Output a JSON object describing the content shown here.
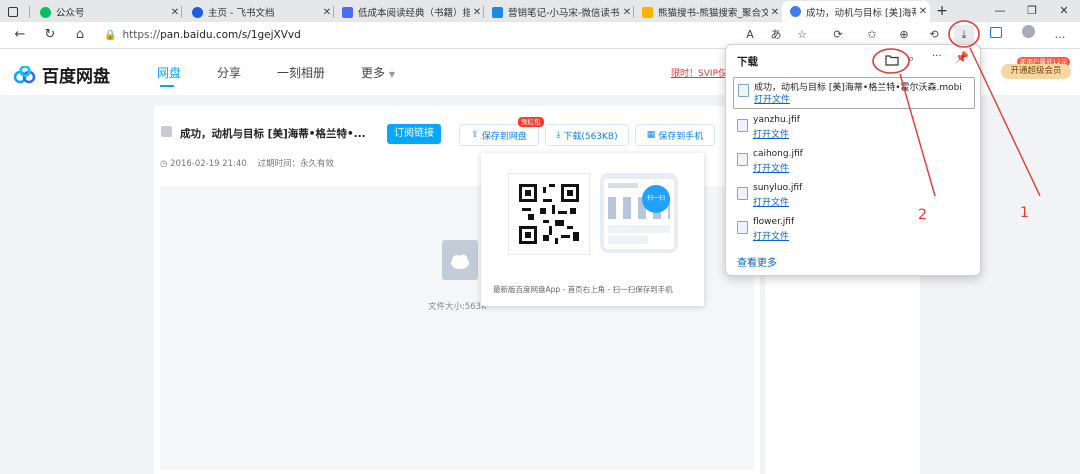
{
  "tabs": [
    {
      "title": "",
      "fav": "#5b6472"
    },
    {
      "title": "公众号",
      "fav": "#07c160"
    },
    {
      "title": "主页 - 飞书文档",
      "fav": "#1c5ce6"
    },
    {
      "title": "低成本阅读经典（书籍）指",
      "fav": "#4a6cf7"
    },
    {
      "title": "营销笔记-小马宋-微信读书",
      "fav": "#1e88e5"
    },
    {
      "title": "熊猫搜书-熊猫搜索_聚合文",
      "fav": "#ffb300"
    },
    {
      "title": "成功，动机与目标 [美]海蒂•",
      "fav": "#3d7ff0"
    }
  ],
  "new_tab": "+",
  "window": {
    "minimize": "—",
    "restore": "❐",
    "close": "✕"
  },
  "address": {
    "url_prefix": "https://",
    "url_rest": "pan.baidu.com/s/1gejXVvd"
  },
  "toolbar_icons": {
    "read_aloud": "A",
    "translate": "あ",
    "star": "☆",
    "ext": "⟳",
    "fav": "✩",
    "collections": "⊕",
    "history": "⟲",
    "download": "⤓",
    "more": "…"
  },
  "bd": {
    "logo_text": "百度网盘",
    "nav": [
      "网盘",
      "分享",
      "一刻相册",
      "更多"
    ],
    "promo": "限时！SVIP仅",
    "vip_tag": "新用户最低12元",
    "vip_btn": "开通超级会员"
  },
  "file": {
    "name": "成功，动机与目标 [美]海蒂•格兰特•...",
    "subscribe": "订阅链接",
    "save_badge": "领红包",
    "save": "保存到网盘",
    "download": "下载(563KB)",
    "save_phone": "保存到手机",
    "date": "2016-02-19 21:40",
    "expire": "过期时间：永久有效",
    "size": "文件大小:563K"
  },
  "qr": {
    "caption": "最新版百度网盘App - 首页右上角 - 扫一扫保存到手机",
    "scan": "扫一扫"
  },
  "downloads": {
    "title": "下载",
    "items": [
      {
        "name": "成功，动机与目标 [美]海蒂•格兰特•霍尔沃森.mobi",
        "action": "打开文件"
      },
      {
        "name": "yanzhu.jfif",
        "action": "打开文件"
      },
      {
        "name": "caihong.jfif",
        "action": "打开文件"
      },
      {
        "name": "sunyluo.jfif",
        "action": "打开文件"
      },
      {
        "name": "flower.jfif",
        "action": "打开文件"
      }
    ],
    "more": "查看更多"
  },
  "annotations": {
    "one": "1",
    "two": "2",
    "color": "#e53935"
  }
}
